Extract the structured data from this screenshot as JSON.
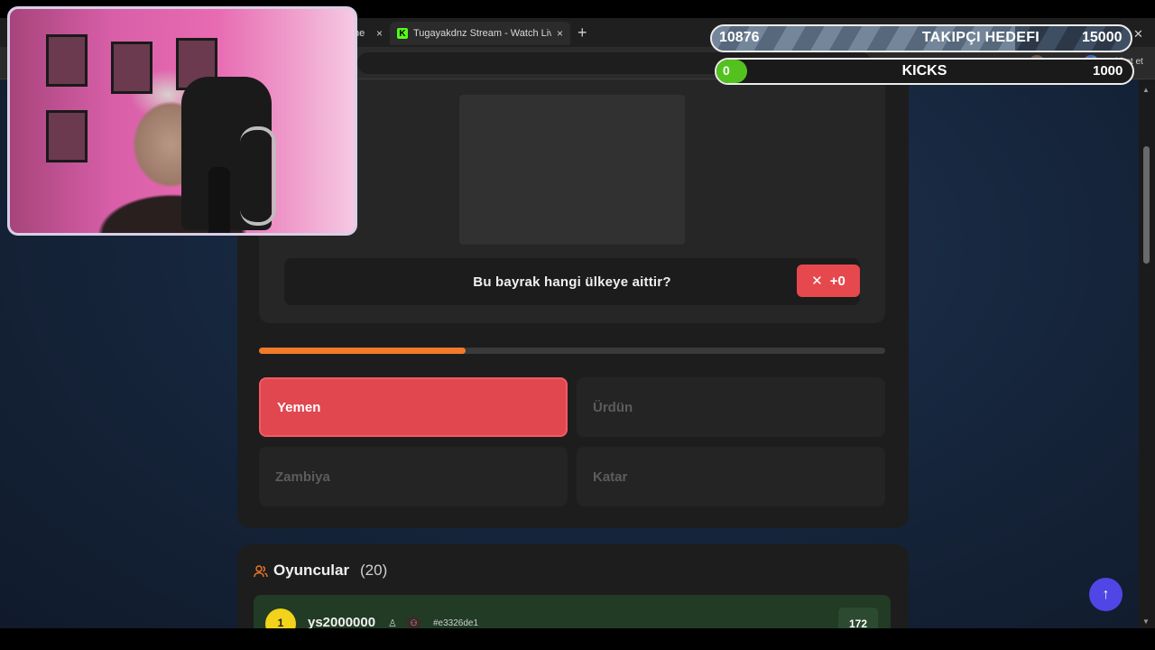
{
  "browser": {
    "tabs": [
      {
        "title": "ne",
        "active": false
      },
      {
        "title": "Tugayakdnz Stream - Watch Live o",
        "active": true,
        "favicon": "K"
      }
    ],
    "close_glyph": "×",
    "new_tab_glyph": "+",
    "chat_label": "Sohbet et"
  },
  "quiz": {
    "question": "Bu bayrak hangi ülkeye aittir?",
    "score_delta": "+0",
    "progress": 0.33,
    "answers": [
      {
        "label": "Yemen",
        "selected": true
      },
      {
        "label": "Ürdün",
        "selected": false
      },
      {
        "label": "Zambiya",
        "selected": false
      },
      {
        "label": "Katar",
        "selected": false
      }
    ]
  },
  "players": {
    "title": "Oyuncular",
    "count": "(20)",
    "list": [
      {
        "rank": "1",
        "name": "ys2000000",
        "id": "#e3326de1",
        "score": "172"
      }
    ]
  },
  "overlay": {
    "follow_goal": {
      "current": "10876",
      "title": "TAKIPÇI HEDEFI",
      "target": "15000",
      "progress": 0.725
    },
    "kicks": {
      "current": "0",
      "title": "KICKS",
      "target": "1000"
    }
  },
  "colors": {
    "accent_red": "#e0474f",
    "progress_orange": "#f07a2a",
    "leader_green": "#213b24",
    "rank_gold": "#f2d21b",
    "scroll_top_purple": "#4f46e5",
    "kick_green": "#53fc18"
  },
  "icons": {
    "close": "close-icon",
    "players": "users-icon",
    "scroll_top": "arrow-up-icon",
    "user": "user-icon",
    "team": "team-icon"
  }
}
